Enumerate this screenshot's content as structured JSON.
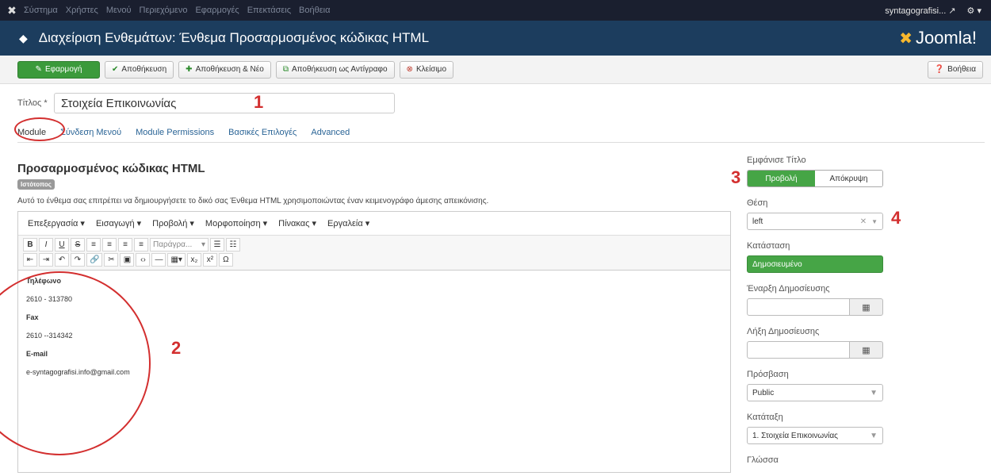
{
  "topnav": {
    "items": [
      "Σύστημα",
      "Χρήστες",
      "Μενού",
      "Περιεχόμενο",
      "Εφαρμογές",
      "Επεκτάσεις",
      "Βοήθεια"
    ],
    "site_name": "syntagografisi...",
    "external_icon": "external-link-icon",
    "settings_icon": "gear-icon"
  },
  "header": {
    "title": "Διαχείριση Ενθεμάτων: Ένθεμα Προσαρμοσμένος κώδικας HTML",
    "brand": "Joomla!",
    "icon": "cube-icon"
  },
  "toolbar": {
    "apply": "Εφαρμογή",
    "save": "Αποθήκευση",
    "save_new": "Αποθήκευση & Νέο",
    "save_copy": "Αποθήκευση ως Αντίγραφο",
    "close": "Κλείσιμο",
    "help": "Βοήθεια"
  },
  "form": {
    "title_label": "Τίτλος *",
    "title_value": "Στοιχεία Επικοινωνίας"
  },
  "annotations": {
    "a1": "1",
    "a2": "2",
    "a3": "3",
    "a4": "4"
  },
  "tabs": [
    "Module",
    "Σύνδεση Μενού",
    "Module Permissions",
    "Βασικές Επιλογές",
    "Advanced"
  ],
  "main": {
    "title": "Προσαρμοσμένος κώδικας HTML",
    "badge": "Ιστότοπος",
    "description": "Αυτό το ένθεμα σας επιτρέπει να δημιουργήσετε το δικό σας Ένθεμα HTML χρησιμοποιώντας έναν κειμενογράφο άμεσης απεικόνισης."
  },
  "editor": {
    "menu": [
      "Επεξεργασία ▾",
      "Εισαγωγή ▾",
      "Προβολή ▾",
      "Μορφοποίηση ▾",
      "Πίνακας ▾",
      "Εργαλεία ▾"
    ],
    "paragraph": "Παράγρα...",
    "content": {
      "phone_label": "Τηλέφωνο",
      "phone": "2610 - 313780",
      "fax_label": "Fax",
      "fax": "2610 --314342",
      "email_label": "E-mail",
      "email": "e-syntagografisi.info@gmail.com"
    }
  },
  "side": {
    "show_title_label": "Εμφάνισε Τίτλο",
    "show": "Προβολή",
    "hide": "Απόκρυψη",
    "position_label": "Θέση",
    "position_value": "left",
    "status_label": "Κατάσταση",
    "status_value": "Δημοσιευμένο",
    "publish_up_label": "Έναρξη Δημοσίευσης",
    "publish_down_label": "Λήξη Δημοσίευσης",
    "access_label": "Πρόσβαση",
    "access_value": "Public",
    "ordering_label": "Κατάταξη",
    "ordering_value": "1. Στοιχεία Επικοινωνίας",
    "language_label": "Γλώσσα"
  }
}
